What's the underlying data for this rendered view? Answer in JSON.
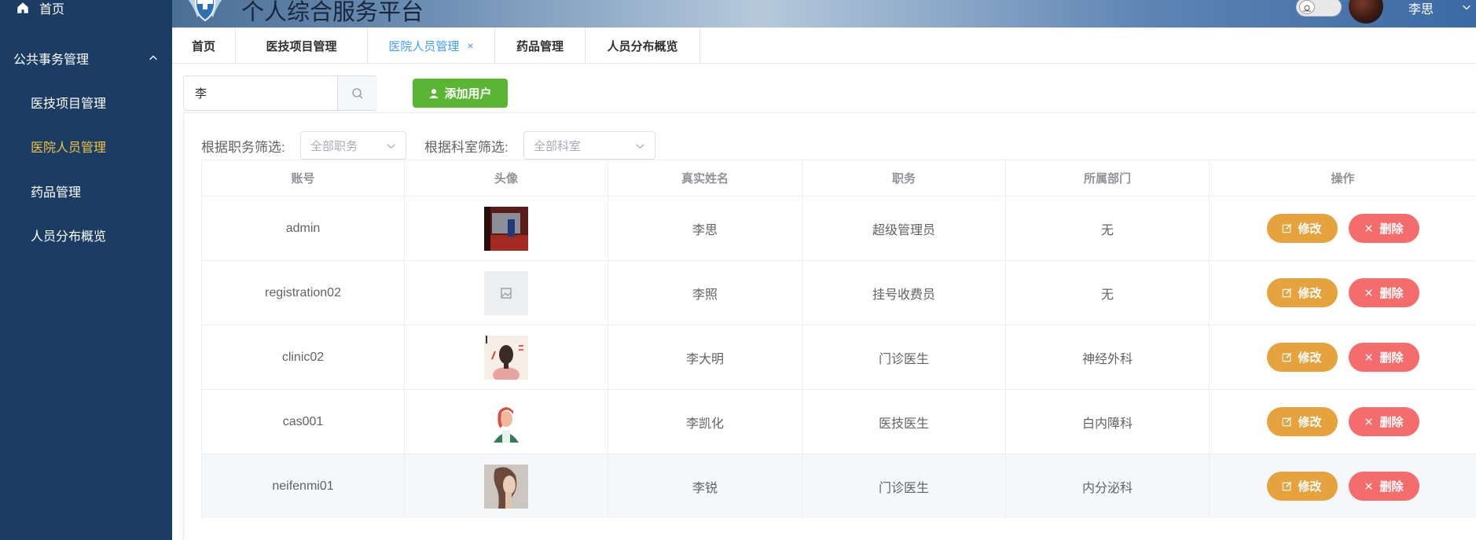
{
  "app": {
    "title": "个人综合服务平台",
    "user_name": "李思"
  },
  "sidebar": {
    "home_label": "首页",
    "group_label": "公共事务管理",
    "items": [
      {
        "label": "医技项目管理"
      },
      {
        "label": "医院人员管理"
      },
      {
        "label": "药品管理"
      },
      {
        "label": "人员分布概览"
      }
    ],
    "active_index": 1,
    "active_color": "#f5c342"
  },
  "tabs": [
    {
      "label": "首页"
    },
    {
      "label": "医技项目管理"
    },
    {
      "label": "医院人员管理",
      "close": "×"
    },
    {
      "label": "药品管理"
    },
    {
      "label": "人员分布概览"
    }
  ],
  "toolbar": {
    "search_value": "李",
    "add_label": "添加用户"
  },
  "filters": {
    "position_label": "根据职务筛选:",
    "position_placeholder": "全部职务",
    "dept_label": "根据科室筛选:",
    "dept_placeholder": "全部科室"
  },
  "table": {
    "columns": [
      "账号",
      "头像",
      "真实姓名",
      "职务",
      "所属部门",
      "操作"
    ],
    "rows": [
      {
        "account": "admin",
        "name": "李思",
        "position": "超级管理员",
        "dept": "无"
      },
      {
        "account": "registration02",
        "name": "李照",
        "position": "挂号收费员",
        "dept": "无"
      },
      {
        "account": "clinic02",
        "name": "李大明",
        "position": "门诊医生",
        "dept": "神经外科"
      },
      {
        "account": "cas001",
        "name": "李凯化",
        "position": "医技医生",
        "dept": "白内障科"
      },
      {
        "account": "neifenmi01",
        "name": "李锐",
        "position": "门诊医生",
        "dept": "内分泌科"
      }
    ],
    "edit_label": "修改",
    "delete_label": "删除"
  },
  "colors": {
    "sidebar_bg": "#1b3d63",
    "primary": "#409eff",
    "success": "#5bb534",
    "warning": "#e6a23c",
    "danger": "#f56c6c"
  }
}
